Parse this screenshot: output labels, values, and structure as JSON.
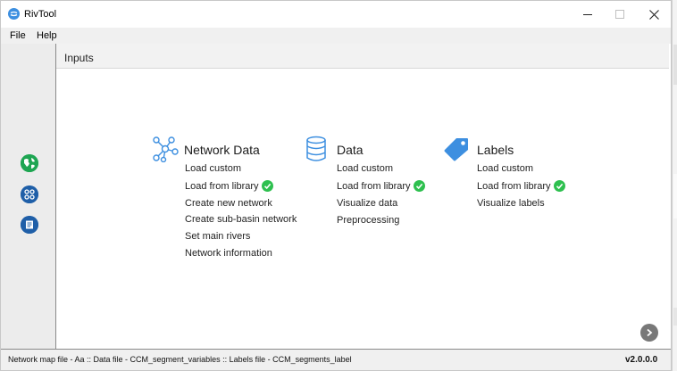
{
  "window": {
    "title": "RivTool"
  },
  "menu": {
    "file": "File",
    "help": "Help"
  },
  "panel": {
    "title": "Inputs"
  },
  "sections": {
    "network": {
      "title": "Network Data",
      "icon": "network-graph-icon",
      "items": [
        "Load custom",
        "Load from library",
        "Create new network",
        "Create sub-basin network",
        "Set main rivers",
        "Network information"
      ]
    },
    "data": {
      "title": "Data",
      "icon": "database-icon",
      "items": [
        "Load custom",
        "Load from library",
        "Visualize data",
        "Preprocessing"
      ]
    },
    "labels": {
      "title": "Labels",
      "icon": "tag-icon",
      "items": [
        "Load custom",
        "Load from library",
        "Visualize labels"
      ]
    }
  },
  "status": {
    "text": "Network map file - Aa  ::  Data file - CCM_segment_variables  ::  Labels file - CCM_segments_label",
    "version": "v2.0.0.0"
  },
  "colors": {
    "accent": "#3d8fe0",
    "check": "#2ec04f",
    "sidebar_button": "#1f5fa8",
    "map_button": "#22b35a"
  }
}
